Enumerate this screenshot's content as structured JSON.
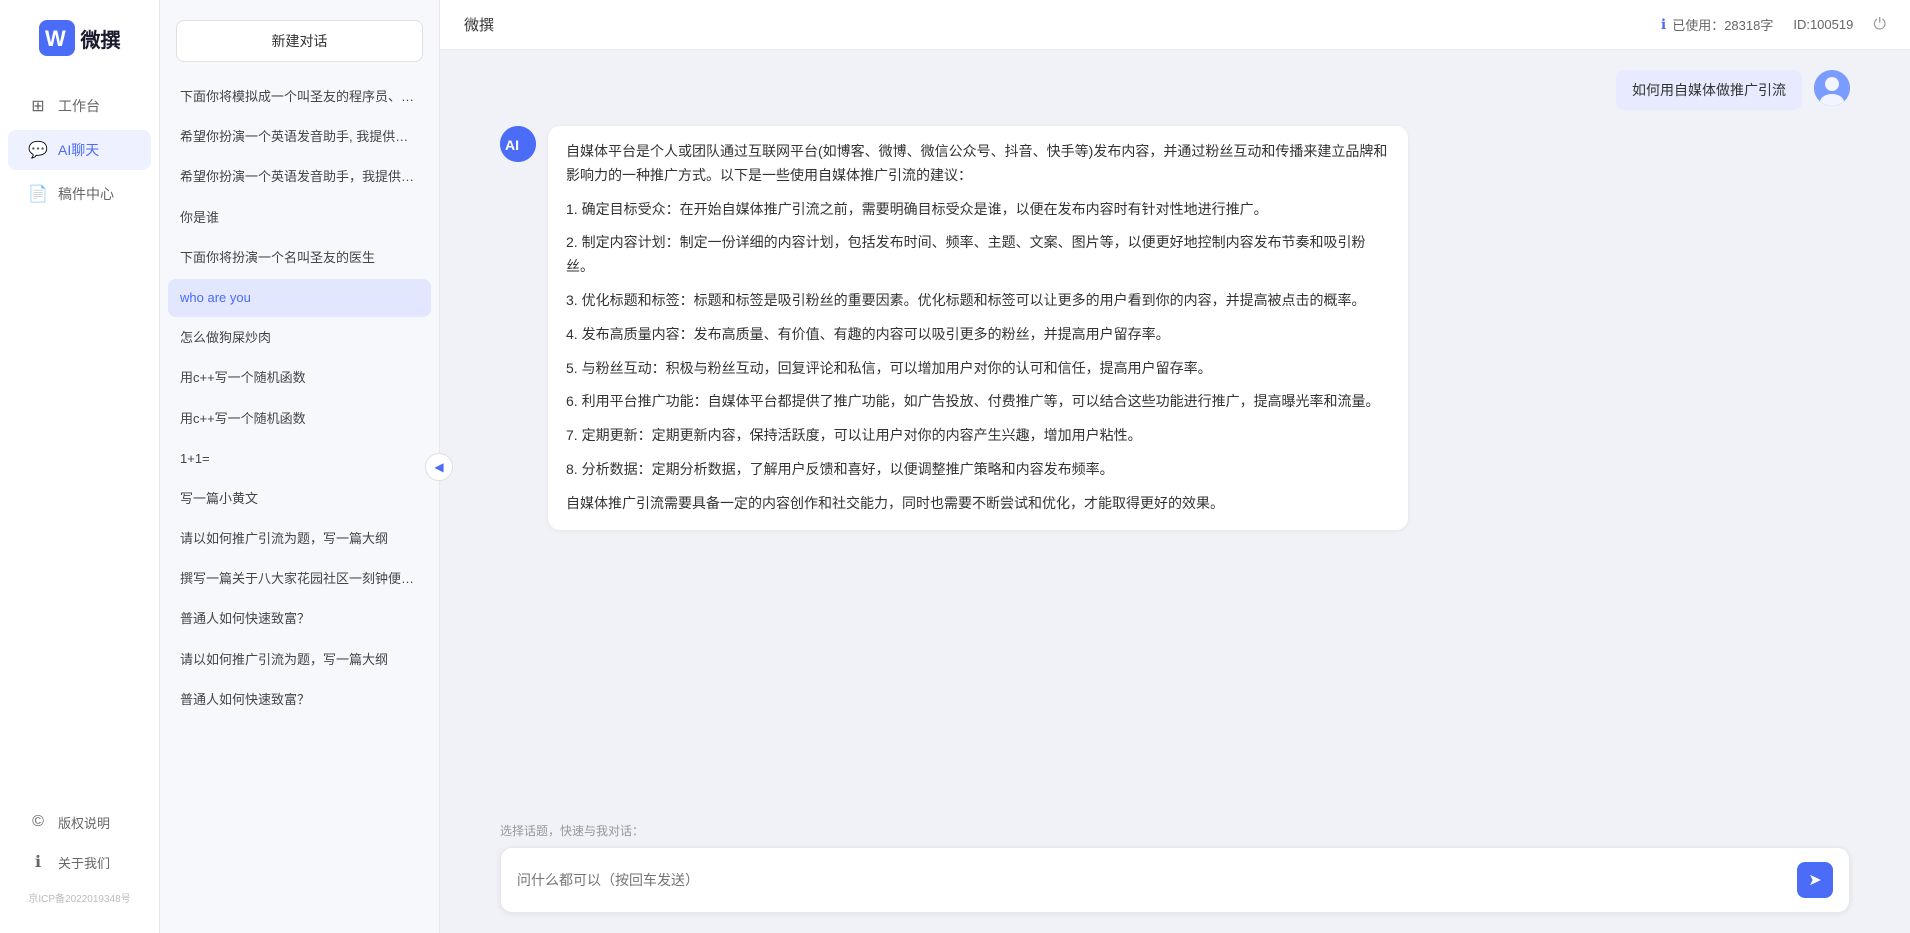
{
  "app": {
    "name": "微撰",
    "page_title": "微撰"
  },
  "topbar": {
    "title": "微撰",
    "usage_label": "已使用：28318字",
    "id_label": "ID:100519",
    "usage_icon": "ℹ",
    "logout_icon": "⏻"
  },
  "sidebar": {
    "nav_items": [
      {
        "id": "workbench",
        "label": "工作台",
        "icon": "⊞",
        "active": false
      },
      {
        "id": "ai-chat",
        "label": "AI聊天",
        "icon": "💬",
        "active": true
      },
      {
        "id": "drafts",
        "label": "稿件中心",
        "icon": "📄",
        "active": false
      }
    ],
    "bottom_items": [
      {
        "id": "copyright",
        "label": "版权说明",
        "icon": "©"
      },
      {
        "id": "about",
        "label": "关于我们",
        "icon": "ℹ"
      }
    ],
    "icp": "京ICP备2022019348号"
  },
  "conv_panel": {
    "new_chat_label": "新建对话",
    "conversations": [
      {
        "id": 1,
        "text": "下面你将模拟成一个叫圣友的程序员、我说...",
        "active": false
      },
      {
        "id": 2,
        "text": "希望你扮演一个英语发音助手, 我提供给你...",
        "active": false
      },
      {
        "id": 3,
        "text": "希望你扮演一个英语发音助手，我提供给你...",
        "active": false
      },
      {
        "id": 4,
        "text": "你是谁",
        "active": false
      },
      {
        "id": 5,
        "text": "下面你将扮演一个名叫圣友的医生",
        "active": false
      },
      {
        "id": 6,
        "text": "who are you",
        "active": true
      },
      {
        "id": 7,
        "text": "怎么做狗屎炒肉",
        "active": false
      },
      {
        "id": 8,
        "text": "用c++写一个随机函数",
        "active": false
      },
      {
        "id": 9,
        "text": "用c++写一个随机函数",
        "active": false
      },
      {
        "id": 10,
        "text": "1+1=",
        "active": false
      },
      {
        "id": 11,
        "text": "写一篇小黄文",
        "active": false
      },
      {
        "id": 12,
        "text": "请以如何推广引流为题，写一篇大纲",
        "active": false
      },
      {
        "id": 13,
        "text": "撰写一篇关于八大家花园社区一刻钟便民生...",
        "active": false
      },
      {
        "id": 14,
        "text": "普通人如何快速致富？",
        "active": false
      },
      {
        "id": 15,
        "text": "请以如何推广引流为题，写一篇大纲",
        "active": false
      },
      {
        "id": 16,
        "text": "普通人如何快速致富？",
        "active": false
      }
    ]
  },
  "chat": {
    "user_message": "如何用自媒体做推广引流",
    "ai_response": {
      "intro": "自媒体平台是个人或团队通过互联网平台(如博客、微博、微信公众号、抖音、快手等)发布内容，并通过粉丝互动和传播来建立品牌和影响力的一种推广方式。以下是一些使用自媒体推广引流的建议：",
      "points": [
        "1. 确定目标受众：在开始自媒体推广引流之前，需要明确目标受众是谁，以便在发布内容时有针对性地进行推广。",
        "2. 制定内容计划：制定一份详细的内容计划，包括发布时间、频率、主题、文案、图片等，以便更好地控制内容发布节奏和吸引粉丝。",
        "3. 优化标题和标签：标题和标签是吸引粉丝的重要因素。优化标题和标签可以让更多的用户看到你的内容，并提高被点击的概率。",
        "4. 发布高质量内容：发布高质量、有价值、有趣的内容可以吸引更多的粉丝，并提高用户留存率。",
        "5. 与粉丝互动：积极与粉丝互动，回复评论和私信，可以增加用户对你的认可和信任，提高用户留存率。",
        "6. 利用平台推广功能：自媒体平台都提供了推广功能，如广告投放、付费推广等，可以结合这些功能进行推广，提高曝光率和流量。",
        "7. 定期更新：定期更新内容，保持活跃度，可以让用户对你的内容产生兴趣，增加用户粘性。",
        "8. 分析数据：定期分析数据，了解用户反馈和喜好，以便调整推广策略和内容发布频率。"
      ],
      "conclusion": "自媒体推广引流需要具备一定的内容创作和社交能力，同时也需要不断尝试和优化，才能取得更好的效果。"
    }
  },
  "input": {
    "quick_topics_label": "选择话题，快速与我对话：",
    "placeholder": "问什么都可以（按回车发送）",
    "send_icon": "➤"
  }
}
